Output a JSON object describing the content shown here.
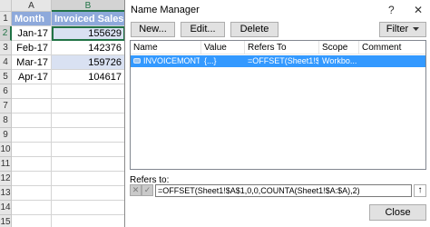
{
  "sheet": {
    "columns": [
      "A",
      "B"
    ],
    "rows": [
      "1",
      "2",
      "3",
      "4",
      "5",
      "6",
      "7",
      "8",
      "9",
      "10",
      "11",
      "12",
      "13",
      "14",
      "15"
    ],
    "header": {
      "a": "Month",
      "b": "Invoiced Sales"
    },
    "data": [
      {
        "month": "Jan-17",
        "sales": "155629"
      },
      {
        "month": "Feb-17",
        "sales": "142376"
      },
      {
        "month": "Mar-17",
        "sales": "159726"
      },
      {
        "month": "Apr-17",
        "sales": "104617"
      }
    ]
  },
  "dialog": {
    "title": "Name Manager",
    "help": "?",
    "close_glyph": "✕",
    "buttons": {
      "new": "New...",
      "edit": "Edit...",
      "delete": "Delete",
      "filter": "Filter",
      "close": "Close"
    },
    "columns": [
      "Name",
      "Value",
      "Refers To",
      "Scope",
      "Comment"
    ],
    "row": {
      "name": "INVOICEMONTH",
      "value": "{...}",
      "refers_to": "=OFFSET(Sheet1!$...",
      "scope": "Workbo..."
    },
    "refers_label": "Refers to:",
    "formula": "=OFFSET(Sheet1!$A$1,0,0,COUNTA(Sheet1!$A:$A),2)",
    "cancel_glyph": "✕",
    "confirm_glyph": "✓",
    "collapse_glyph": "↑"
  },
  "colors": {
    "selection": "#3399ff",
    "header_fill": "#8ea9db",
    "excel_green": "#217346"
  }
}
